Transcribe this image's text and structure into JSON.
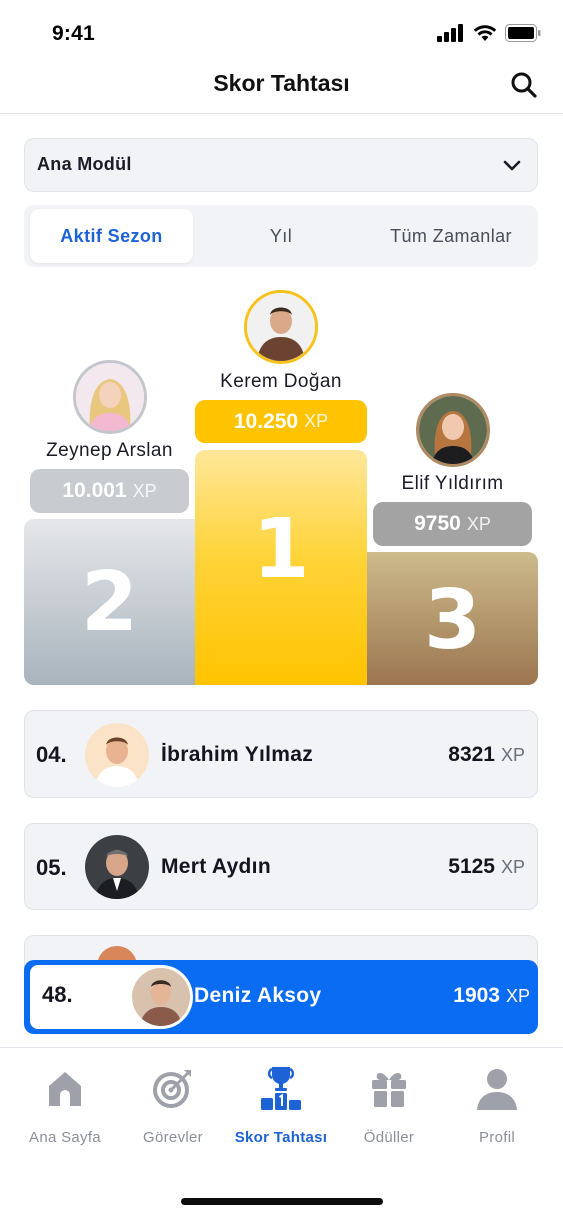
{
  "status": {
    "time": "9:41"
  },
  "header": {
    "title": "Skor Tahtası",
    "search_icon": "search-icon"
  },
  "module_select": {
    "selected": "Ana Modül",
    "icon": "chevron-down-icon"
  },
  "tabs": [
    {
      "label": "Aktif Sezon",
      "active": true
    },
    {
      "label": "Yıl",
      "active": false
    },
    {
      "label": "Tüm Zamanlar",
      "active": false
    }
  ],
  "podium": {
    "first": {
      "rank": "1",
      "name": "Kerem Doğan",
      "xp": "10.250",
      "unit": "XP"
    },
    "second": {
      "rank": "2",
      "name": "Zeynep Arslan",
      "xp": "10.001",
      "unit": "XP"
    },
    "third": {
      "rank": "3",
      "name": "Elif Yıldırım",
      "xp": "9750",
      "unit": "XP"
    }
  },
  "leaderboard": [
    {
      "rank": "04.",
      "name": "İbrahim Yılmaz",
      "xp": "8321",
      "unit": "XP"
    },
    {
      "rank": "05.",
      "name": "Mert Aydın",
      "xp": "5125",
      "unit": "XP"
    }
  ],
  "current_user": {
    "rank": "48.",
    "name": "Deniz Aksoy",
    "xp": "1903",
    "unit": "XP"
  },
  "nav": [
    {
      "label": "Ana Sayfa",
      "icon": "home-icon",
      "active": false
    },
    {
      "label": "Görevler",
      "icon": "target-icon",
      "active": false
    },
    {
      "label": "Skor Tahtası",
      "icon": "podium-trophy-icon",
      "active": true
    },
    {
      "label": "Ödüller",
      "icon": "gift-icon",
      "active": false
    },
    {
      "label": "Profil",
      "icon": "user-icon",
      "active": false
    }
  ],
  "colors": {
    "accent": "#0A6CF2",
    "tab_active": "#1E63D6",
    "gold": "#FFC300",
    "silver": "#C9CCD1",
    "bronze": "#A88A60"
  }
}
